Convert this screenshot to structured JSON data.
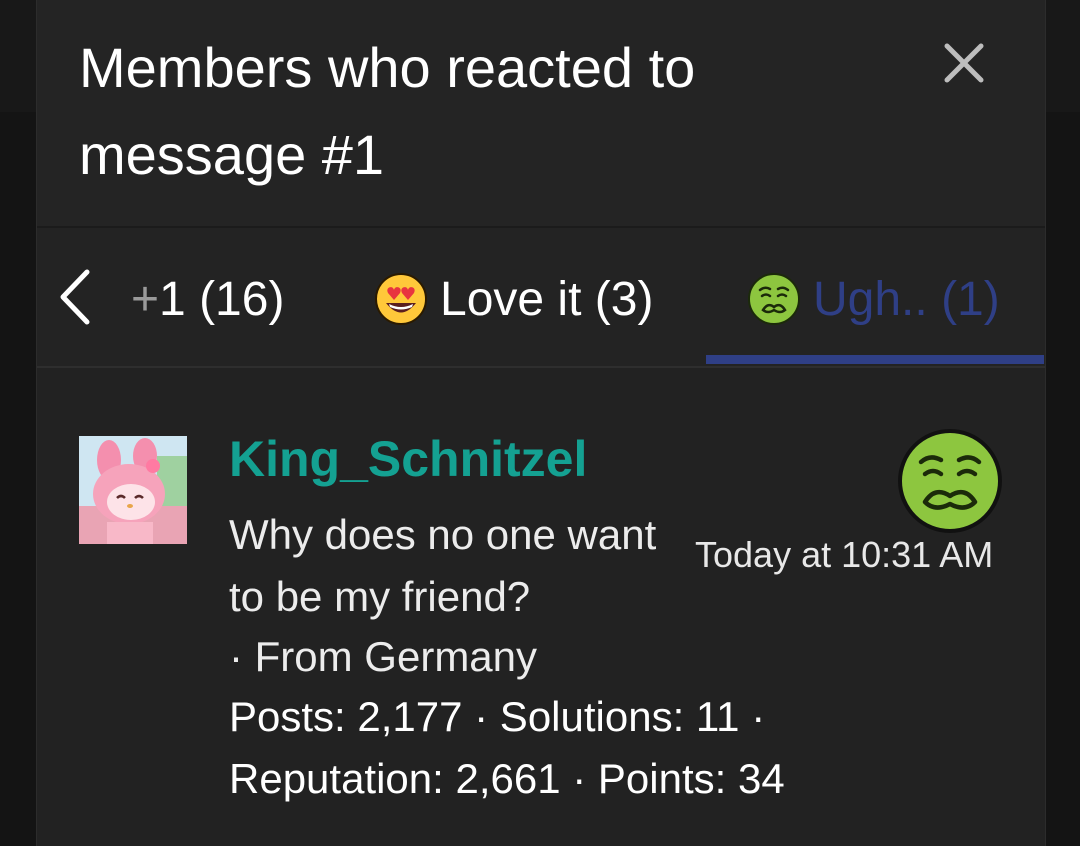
{
  "dialog": {
    "title": "Members who reacted to message #1",
    "close_icon": "close-icon"
  },
  "tabs": {
    "prev_icon": "chevron-left-icon",
    "items": [
      {
        "label_prefix": "+",
        "label": "1 (16)",
        "icon": null,
        "active": false
      },
      {
        "label": "Love it (3)",
        "icon": "heart-eyes-emoji-icon",
        "active": false
      },
      {
        "label": "Ugh.. (1)",
        "icon": "nauseated-face-emoji-icon",
        "active": true
      }
    ],
    "active_color": "#2f3f86"
  },
  "member": {
    "username": "King_Schnitzel",
    "username_color": "#14a192",
    "title": "Why does no one want to be my friend?",
    "location": "· From Germany",
    "stats_line1": "Posts: 2,177 · Solutions: 11 ·",
    "stats_line2": "Reputation: 2,661 · Points: 34",
    "timestamp": "Today at 10:31 AM",
    "reaction_icon": "nauseated-face-emoji-icon",
    "avatar_icon": "pink-bunny-character-avatar"
  }
}
